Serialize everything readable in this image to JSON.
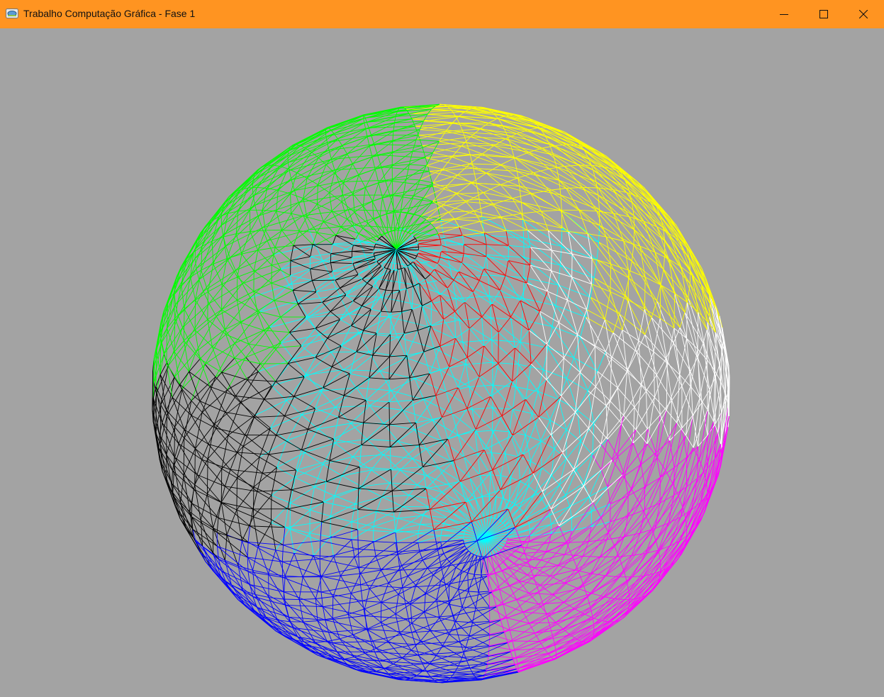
{
  "window": {
    "title": "Trabalho Computação Gráfica - Fase 1",
    "titlebar_color": "#ff9421",
    "background_color": "#a3a3a3",
    "app_icon": "glut-window-icon",
    "controls": {
      "minimize_icon": "minimize-icon",
      "maximize_icon": "maximize-icon",
      "close_icon": "close-icon"
    }
  },
  "scene": {
    "object": "wireframe-sphere",
    "render_mode": "wireframe-triangles",
    "colors": {
      "green": "#00ff00",
      "yellow": "#ffff00",
      "red": "#ff0000",
      "cyan": "#00ffff",
      "black": "#000000",
      "white": "#ffffff",
      "magenta": "#ff00ff",
      "blue": "#0000ff"
    }
  }
}
